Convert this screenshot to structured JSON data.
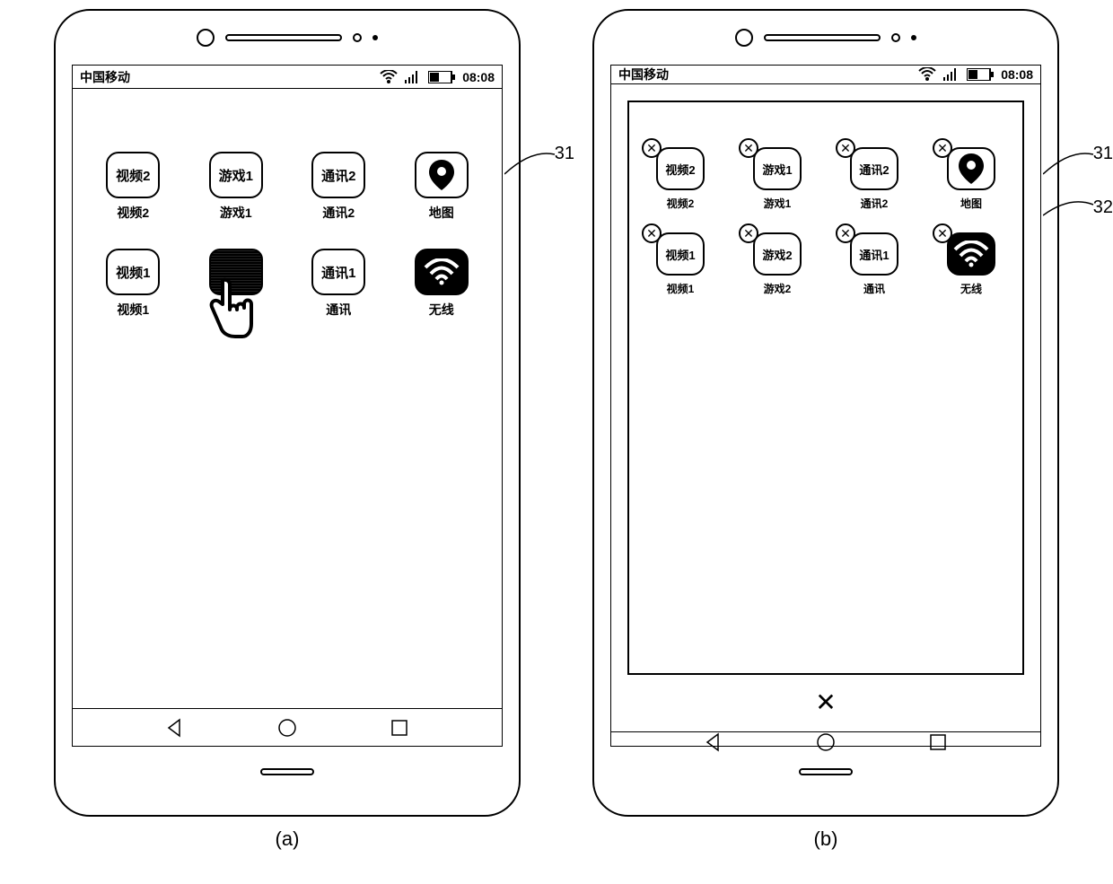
{
  "status": {
    "carrier": "中国移动",
    "time": "08:08"
  },
  "callouts": {
    "a": "31",
    "b1": "31",
    "b2": "32"
  },
  "subfig": {
    "a": "(a)",
    "b": "(b)"
  },
  "appsA": [
    {
      "icon_text": "视频2",
      "label": "视频2",
      "type": "text"
    },
    {
      "icon_text": "游戏1",
      "label": "游戏1",
      "type": "text"
    },
    {
      "icon_text": "通讯2",
      "label": "通讯2",
      "type": "text"
    },
    {
      "icon_text": "",
      "label": "地图",
      "type": "map"
    },
    {
      "icon_text": "视频1",
      "label": "视频1",
      "type": "text"
    },
    {
      "icon_text": "",
      "label": "",
      "type": "hatched_hand"
    },
    {
      "icon_text": "通讯1",
      "label": "通讯",
      "type": "text"
    },
    {
      "icon_text": "",
      "label": "无线",
      "type": "wifi"
    }
  ],
  "appsB": [
    {
      "icon_text": "视频2",
      "label": "视频2",
      "type": "text"
    },
    {
      "icon_text": "游戏1",
      "label": "游戏1",
      "type": "text"
    },
    {
      "icon_text": "通讯2",
      "label": "通讯2",
      "type": "text"
    },
    {
      "icon_text": "",
      "label": "地图",
      "type": "map"
    },
    {
      "icon_text": "视频1",
      "label": "视频1",
      "type": "text"
    },
    {
      "icon_text": "游戏2",
      "label": "游戏2",
      "type": "text"
    },
    {
      "icon_text": "通讯1",
      "label": "通讯",
      "type": "text"
    },
    {
      "icon_text": "",
      "label": "无线",
      "type": "wifi"
    }
  ],
  "close_symbol": "✕"
}
